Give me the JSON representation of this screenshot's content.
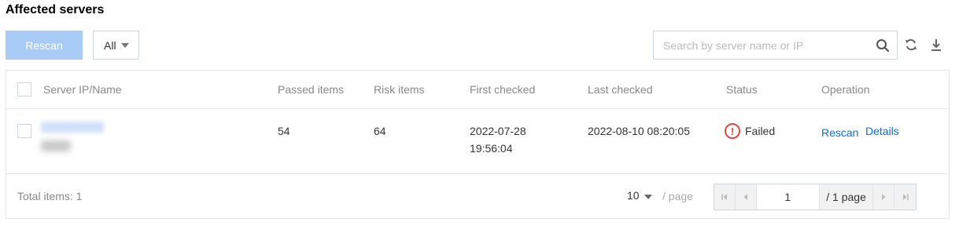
{
  "title": "Affected servers",
  "toolbar": {
    "rescan_label": "Rescan",
    "filter_value": "All",
    "search_placeholder": "Search by server name or IP",
    "icons": [
      "search-icon",
      "refresh-icon",
      "download-icon"
    ]
  },
  "table": {
    "headers": {
      "server": "Server IP/Name",
      "passed": "Passed items",
      "risk": "Risk items",
      "first": "First checked",
      "last": "Last checked",
      "status": "Status",
      "operation": "Operation"
    },
    "rows": [
      {
        "passed": "54",
        "risk": "64",
        "first_date": "2022-07-28",
        "first_time": "19:56:04",
        "last": "2022-08-10 08:20:05",
        "status": "Failed",
        "op_rescan": "Rescan",
        "op_details": "Details"
      }
    ]
  },
  "footer": {
    "total": "Total items:  1",
    "page_size": "10",
    "per_page": "/ page",
    "current_page": "1",
    "total_pages": "/ 1 page"
  },
  "colors": {
    "accent": "#006eff",
    "disabled_button": "#a9ccf6",
    "failed": "#e54545",
    "border": "#e3e6eb"
  }
}
